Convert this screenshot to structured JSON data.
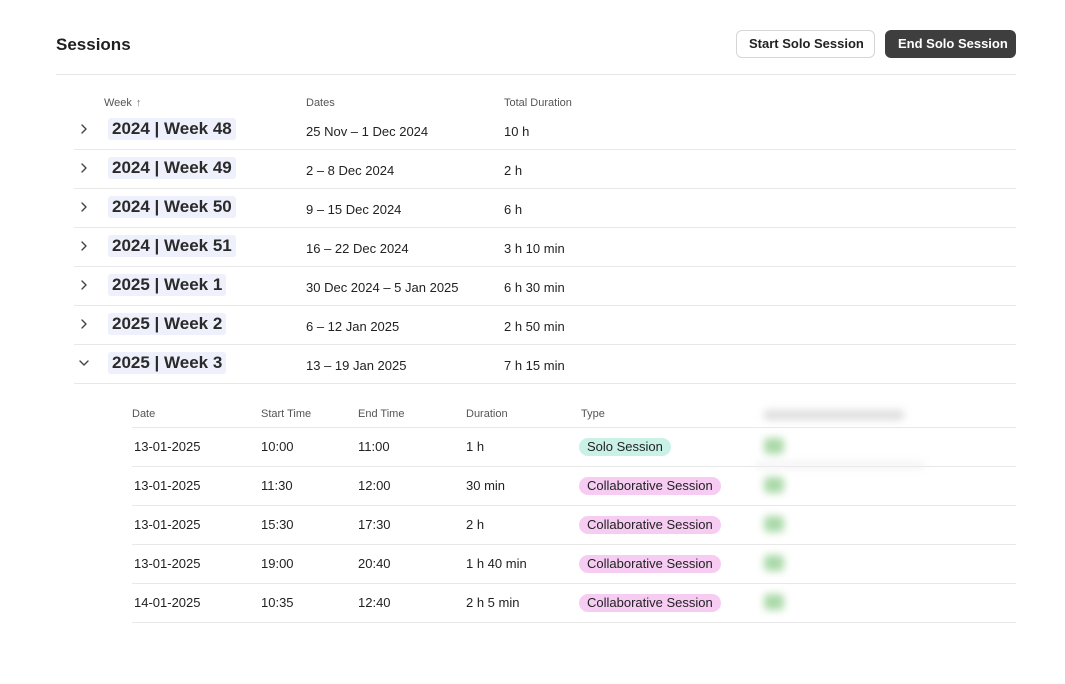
{
  "header": {
    "title": "Sessions",
    "start_label": "Start Solo Session",
    "end_label": "End Solo Session"
  },
  "columns": {
    "week": "Week",
    "dates": "Dates",
    "total_duration": "Total Duration"
  },
  "weeks": [
    {
      "label": "2024 | Week 48",
      "dates": "25 Nov – 1 Dec 2024",
      "duration": "10 h",
      "expanded": false
    },
    {
      "label": "2024 | Week 49",
      "dates": "2 – 8 Dec 2024",
      "duration": "2 h",
      "expanded": false
    },
    {
      "label": "2024 | Week 50",
      "dates": "9 – 15 Dec 2024",
      "duration": "6 h",
      "expanded": false
    },
    {
      "label": "2024 | Week 51",
      "dates": "16 – 22 Dec 2024",
      "duration": "3 h 10 min",
      "expanded": false
    },
    {
      "label": "2025 | Week 1",
      "dates": "30 Dec 2024 – 5 Jan 2025",
      "duration": "6 h 30 min",
      "expanded": false
    },
    {
      "label": "2025 | Week 2",
      "dates": "6 – 12 Jan 2025",
      "duration": "2 h 50 min",
      "expanded": false
    },
    {
      "label": "2025 | Week 3",
      "dates": "13 – 19 Jan 2025",
      "duration": "7 h 15 min",
      "expanded": true
    }
  ],
  "sessions": {
    "columns": {
      "date": "Date",
      "start": "Start Time",
      "end": "End Time",
      "duration": "Duration",
      "type": "Type"
    },
    "rows": [
      {
        "date": "13-01-2025",
        "start": "10:00",
        "end": "11:00",
        "duration": "1 h",
        "type": "Solo Session"
      },
      {
        "date": "13-01-2025",
        "start": "11:30",
        "end": "12:00",
        "duration": "30 min",
        "type": "Collaborative Session"
      },
      {
        "date": "13-01-2025",
        "start": "15:30",
        "end": "17:30",
        "duration": "2 h",
        "type": "Collaborative Session"
      },
      {
        "date": "13-01-2025",
        "start": "19:00",
        "end": "20:40",
        "duration": "1 h 40 min",
        "type": "Collaborative Session"
      },
      {
        "date": "14-01-2025",
        "start": "10:35",
        "end": "12:40",
        "duration": "2 h 5 min",
        "type": "Collaborative Session"
      }
    ]
  },
  "colors": {
    "solo": "#c9f1e6",
    "collaborative": "#f6ccf2",
    "primary_button": "#3e3e3e",
    "week_label_bg": "#eef0fb"
  }
}
